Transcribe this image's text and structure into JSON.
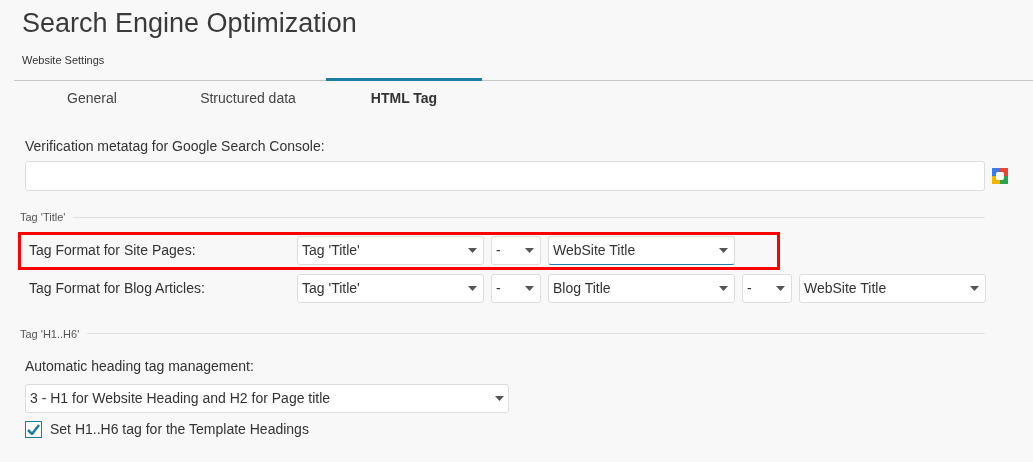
{
  "title": "Search Engine Optimization",
  "subtitle": "Website Settings",
  "tabs": [
    {
      "label": "General",
      "selected": false
    },
    {
      "label": "Structured data",
      "selected": false
    },
    {
      "label": "HTML Tag",
      "selected": true
    }
  ],
  "verification": {
    "label": "Verification metatag for Google Search Console:"
  },
  "title_section": {
    "heading": "Tag 'Title'",
    "rows": [
      {
        "label": "Tag Format for Site Pages:",
        "highlighted": true,
        "selects": [
          {
            "kind": "wide",
            "value": "Tag 'Title'",
            "focused": false
          },
          {
            "kind": "narrow",
            "value": "-",
            "focused": false
          },
          {
            "kind": "wide",
            "value": "WebSite Title",
            "focused": true
          }
        ]
      },
      {
        "label": "Tag Format for Blog Articles:",
        "highlighted": false,
        "selects": [
          {
            "kind": "wide",
            "value": "Tag 'Title'",
            "focused": false
          },
          {
            "kind": "narrow",
            "value": "-",
            "focused": false
          },
          {
            "kind": "wide",
            "value": "Blog Title",
            "focused": false
          },
          {
            "kind": "narrow",
            "value": "-",
            "focused": false
          },
          {
            "kind": "wide",
            "value": "WebSite Title",
            "focused": false
          }
        ]
      }
    ]
  },
  "heading_section": {
    "heading": "Tag 'H1..H6'",
    "label": "Automatic heading tag management:",
    "value": "3 - H1 for Website Heading and H2 for Page title",
    "checkbox": {
      "label": "Set H1..H6 tag for the Template Headings",
      "checked": true
    }
  }
}
